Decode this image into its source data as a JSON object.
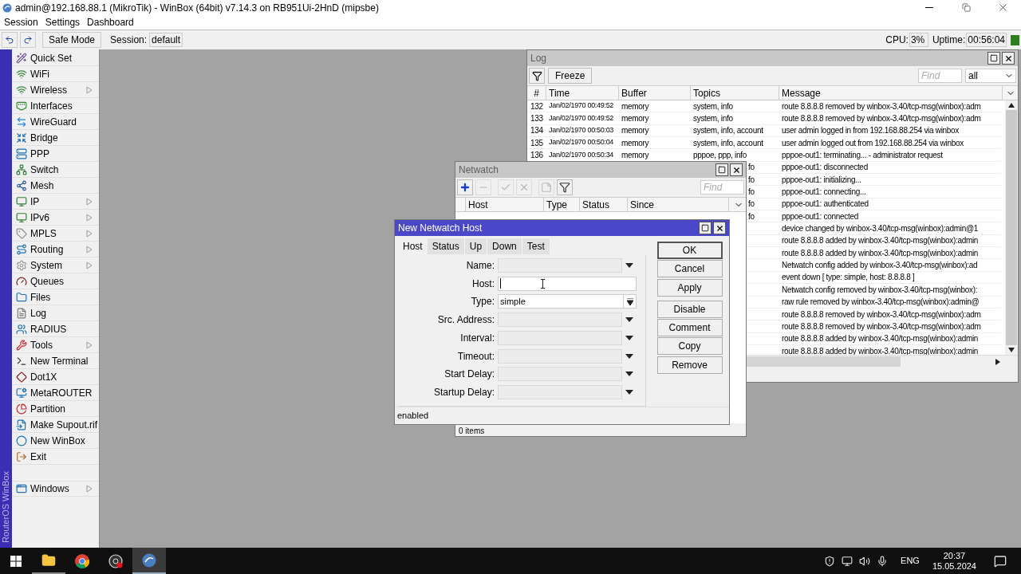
{
  "window": {
    "title": "admin@192.168.88.1 (MikroTik) - WinBox (64bit) v7.14.3 on RB951Ui-2HnD (mipsbe)"
  },
  "menu": [
    "Session",
    "Settings",
    "Dashboard"
  ],
  "toolbar": {
    "safe_mode": "Safe Mode",
    "session_label": "Session:",
    "session_value": "default",
    "cpu_label": "CPU:",
    "cpu_value": "3%",
    "uptime_label": "Uptime:",
    "uptime_value": "00:56:04"
  },
  "sidebar": {
    "brand": "RouterOS WinBox",
    "items": [
      {
        "label": "Quick Set",
        "has_submenu": false
      },
      {
        "label": "WiFi",
        "has_submenu": false
      },
      {
        "label": "Wireless",
        "has_submenu": true
      },
      {
        "label": "Interfaces",
        "has_submenu": false
      },
      {
        "label": "WireGuard",
        "has_submenu": false
      },
      {
        "label": "Bridge",
        "has_submenu": false
      },
      {
        "label": "PPP",
        "has_submenu": false
      },
      {
        "label": "Switch",
        "has_submenu": false
      },
      {
        "label": "Mesh",
        "has_submenu": false
      },
      {
        "label": "IP",
        "has_submenu": true
      },
      {
        "label": "IPv6",
        "has_submenu": true
      },
      {
        "label": "MPLS",
        "has_submenu": true
      },
      {
        "label": "Routing",
        "has_submenu": true
      },
      {
        "label": "System",
        "has_submenu": true
      },
      {
        "label": "Queues",
        "has_submenu": false
      },
      {
        "label": "Files",
        "has_submenu": false
      },
      {
        "label": "Log",
        "has_submenu": false
      },
      {
        "label": "RADIUS",
        "has_submenu": false
      },
      {
        "label": "Tools",
        "has_submenu": true
      },
      {
        "label": "New Terminal",
        "has_submenu": false
      },
      {
        "label": "Dot1X",
        "has_submenu": false
      },
      {
        "label": "MetaROUTER",
        "has_submenu": false
      },
      {
        "label": "Partition",
        "has_submenu": false
      },
      {
        "label": "Make Supout.rif",
        "has_submenu": false
      },
      {
        "label": "New WinBox",
        "has_submenu": false
      },
      {
        "label": "Exit",
        "has_submenu": false
      }
    ],
    "bottom_item": {
      "label": "Windows",
      "has_submenu": true
    }
  },
  "log": {
    "title": "Log",
    "active": false,
    "freeze": "Freeze",
    "find_placeholder": "Find",
    "filter_value": "all",
    "columns": [
      "#",
      "Time",
      "Buffer",
      "Topics",
      "Message"
    ],
    "rows": [
      {
        "num": "132",
        "time": "Jan/02/1970 00:49:52",
        "buffer": "memory",
        "topics": "system, info",
        "message": "route 8.8.8.8 removed by winbox-3.40/tcp-msg(winbox):adm"
      },
      {
        "num": "133",
        "time": "Jan/02/1970 00:49:52",
        "buffer": "memory",
        "topics": "system, info",
        "message": "route 8.8.8.8 removed by winbox-3.40/tcp-msg(winbox):adm"
      },
      {
        "num": "134",
        "time": "Jan/02/1970 00:50:03",
        "buffer": "memory",
        "topics": "system, info, account",
        "message": "user admin logged in from 192.168.88.254 via winbox"
      },
      {
        "num": "135",
        "time": "Jan/02/1970 00:50:04",
        "buffer": "memory",
        "topics": "system, info, account",
        "message": "user admin logged out from 192.168.88.254 via winbox"
      },
      {
        "num": "136",
        "time": "Jan/02/1970 00:50:34",
        "buffer": "memory",
        "topics": "pppoe, ppp, info",
        "message": "pppoe-out1: terminating... - administrator request"
      },
      {
        "topics": "fo",
        "message": "pppoe-out1: disconnected"
      },
      {
        "topics": "fo",
        "message": "pppoe-out1: initializing..."
      },
      {
        "topics": "fo",
        "message": "pppoe-out1: connecting..."
      },
      {
        "topics": "fo",
        "message": "pppoe-out1: authenticated"
      },
      {
        "topics": "fo",
        "message": "pppoe-out1: connected"
      },
      {
        "message": "device changed by winbox-3.40/tcp-msg(winbox):admin@1"
      },
      {
        "message": "route 8.8.8.8 added by winbox-3.40/tcp-msg(winbox):admin"
      },
      {
        "message": "route 8.8.8.8 added by winbox-3.40/tcp-msg(winbox):admin"
      },
      {
        "message": "Netwatch config added by winbox-3.40/tcp-msg(winbox):ad"
      },
      {
        "message": "event down [ type: simple, host: 8.8.8.8 ]"
      },
      {
        "message": "Netwatch config removed by winbox-3.40/tcp-msg(winbox):"
      },
      {
        "message": "raw rule removed by winbox-3.40/tcp-msg(winbox):admin@"
      },
      {
        "message": "route 8.8.8.8 removed by winbox-3.40/tcp-msg(winbox):adm"
      },
      {
        "message": "route 8.8.8.8 removed by winbox-3.40/tcp-msg(winbox):adm"
      },
      {
        "message": "route 8.8.8.8 added by winbox-3.40/tcp-msg(winbox):admin"
      },
      {
        "message": "route 8.8.8.8 added by winbox-3.40/tcp-msg(winbox):admin"
      }
    ]
  },
  "netwatch": {
    "title": "Netwatch",
    "active": false,
    "find_placeholder": "Find",
    "tools": [
      {
        "kind": "add",
        "disabled": false
      },
      {
        "kind": "remove",
        "disabled": true
      },
      {
        "kind": "enable",
        "disabled": true
      },
      {
        "kind": "disable",
        "disabled": true
      },
      {
        "kind": "comment",
        "disabled": true
      },
      {
        "kind": "filter",
        "disabled": false
      }
    ],
    "columns": [
      "Host",
      "Type",
      "Status",
      "Since"
    ],
    "status": "0 items"
  },
  "dialog": {
    "title": "New Netwatch Host",
    "active": true,
    "tabs": [
      {
        "label": "Host",
        "selected": true
      },
      {
        "label": "Status",
        "selected": false
      },
      {
        "label": "Up",
        "selected": false
      },
      {
        "label": "Down",
        "selected": false
      },
      {
        "label": "Test",
        "selected": false
      }
    ],
    "fields": [
      {
        "label": "Name:",
        "kind": "dropdown"
      },
      {
        "label": "Host:",
        "kind": "text"
      },
      {
        "label": "Type:",
        "kind": "combo",
        "value": "simple"
      },
      {
        "label": "Src. Address:",
        "kind": "dropdown"
      },
      {
        "label": "Interval:",
        "kind": "dropdown"
      },
      {
        "label": "Timeout:",
        "kind": "dropdown"
      },
      {
        "label": "Start Delay:",
        "kind": "dropdown"
      },
      {
        "label": "Startup Delay:",
        "kind": "dropdown"
      }
    ],
    "buttons": [
      "OK",
      "Cancel",
      "Apply",
      "Disable",
      "Comment",
      "Copy",
      "Remove"
    ],
    "status": "enabled"
  },
  "taskbar": {
    "language": "ENG",
    "time": "20:37",
    "date": "15.05.2024"
  }
}
